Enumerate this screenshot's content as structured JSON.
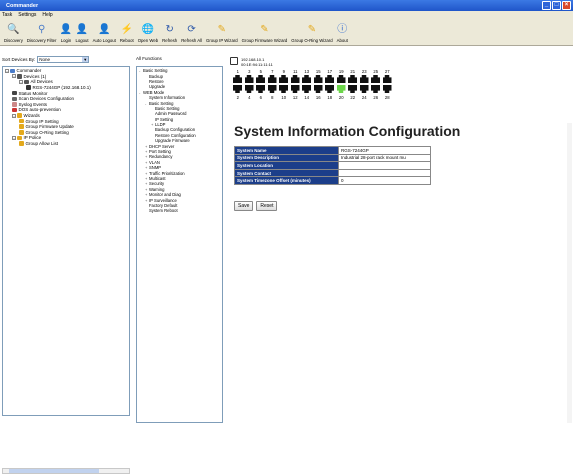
{
  "window": {
    "title": "Commander"
  },
  "menu": [
    "Task",
    "Settings",
    "Help"
  ],
  "toolbar": [
    {
      "label": "Discovery",
      "icon": "magnifier-icon",
      "color": "#4a7cc9"
    },
    {
      "label": "Discovery Filter",
      "icon": "filter-icon",
      "color": "#4a7cc9"
    },
    {
      "label": "Login",
      "icon": "login-icon",
      "color": "#3b6fc0"
    },
    {
      "label": "Logout",
      "icon": "logout-icon",
      "color": "#3b6fc0"
    },
    {
      "label": "Auto Logout",
      "icon": "auto-logout-icon",
      "color": "#3ea63b"
    },
    {
      "label": "Reboot",
      "icon": "reboot-icon",
      "color": "#d13a2f"
    },
    {
      "label": "Open Web",
      "icon": "open-web-icon",
      "color": "#3b6fc0"
    },
    {
      "label": "Refresh",
      "icon": "refresh-icon",
      "color": "#2b57a8"
    },
    {
      "label": "Refresh All",
      "icon": "refresh-all-icon",
      "color": "#2b57a8"
    },
    {
      "label": "Group IP Wizard",
      "icon": "wand-icon",
      "color": "#e3a91d"
    },
    {
      "label": "Group Firmware Wizard",
      "icon": "wand-icon",
      "color": "#e3a91d"
    },
    {
      "label": "Group O-Ring Wizard",
      "icon": "wand-icon",
      "color": "#e3a91d"
    },
    {
      "label": "About",
      "icon": "info-icon",
      "color": "#2a66d0"
    }
  ],
  "left": {
    "sort_label": "Sort Devices By:",
    "sort_value": "None",
    "tree": [
      {
        "label": "Commander",
        "depth": 0,
        "box": "-",
        "icon": "#4a7cc9"
      },
      {
        "label": "Devices (1)",
        "depth": 1,
        "box": "-",
        "icon": "#555"
      },
      {
        "label": "All Devices",
        "depth": 2,
        "box": "-",
        "icon": "#555"
      },
      {
        "label": "RGS-7244GP (192.168.10.1)",
        "depth": 3,
        "box": "",
        "icon": "#333"
      },
      {
        "label": "Status Monitor",
        "depth": 1,
        "box": "",
        "icon": "#444"
      },
      {
        "label": "Scan Devices Configuration",
        "depth": 1,
        "box": "",
        "icon": "#666"
      },
      {
        "label": "Syslog Events",
        "depth": 1,
        "box": "",
        "icon": "#c88"
      },
      {
        "label": "DOS auto-prevention",
        "depth": 1,
        "box": "",
        "icon": "#c33"
      },
      {
        "label": "Wizards",
        "depth": 1,
        "box": "-",
        "icon": "#e3a91d"
      },
      {
        "label": "Group IP Setting",
        "depth": 2,
        "box": "",
        "icon": "#e3a91d"
      },
      {
        "label": "Group Firmware Update",
        "depth": 2,
        "box": "",
        "icon": "#e3a91d"
      },
      {
        "label": "Group O-Ring Setting",
        "depth": 2,
        "box": "",
        "icon": "#e3a91d"
      },
      {
        "label": "IP Police",
        "depth": 1,
        "box": "-",
        "icon": "#e3a91d"
      },
      {
        "label": "Group Allow List",
        "depth": 2,
        "box": "",
        "icon": "#e3a91d"
      }
    ]
  },
  "functions": {
    "label": "All Functions",
    "items": [
      {
        "label": "Basic Setting",
        "depth": 0,
        "exp": "-"
      },
      {
        "label": "Backup",
        "depth": 1,
        "exp": ""
      },
      {
        "label": "Restore",
        "depth": 1,
        "exp": ""
      },
      {
        "label": "Upgrade",
        "depth": 1,
        "exp": ""
      },
      {
        "label": "WEB Mode",
        "depth": 0,
        "exp": "-"
      },
      {
        "label": "System Information",
        "depth": 1,
        "exp": ""
      },
      {
        "label": "Basic Setting",
        "depth": 1,
        "exp": "-"
      },
      {
        "label": "Basic Setting",
        "depth": 2,
        "exp": ""
      },
      {
        "label": "Admin Password",
        "depth": 2,
        "exp": ""
      },
      {
        "label": "IP Setting",
        "depth": 2,
        "exp": ""
      },
      {
        "label": "LLDP",
        "depth": 2,
        "exp": "+"
      },
      {
        "label": "Backup Configuration",
        "depth": 2,
        "exp": ""
      },
      {
        "label": "Restore Configuration",
        "depth": 2,
        "exp": ""
      },
      {
        "label": "Upgrade Firmware",
        "depth": 2,
        "exp": ""
      },
      {
        "label": "DHCP Server",
        "depth": 1,
        "exp": "+"
      },
      {
        "label": "Port Setting",
        "depth": 1,
        "exp": "+"
      },
      {
        "label": "Redundancy",
        "depth": 1,
        "exp": "+"
      },
      {
        "label": "VLAN",
        "depth": 1,
        "exp": "+"
      },
      {
        "label": "SNMP",
        "depth": 1,
        "exp": "+"
      },
      {
        "label": "Traffic Prioritization",
        "depth": 1,
        "exp": "+"
      },
      {
        "label": "Multicast",
        "depth": 1,
        "exp": "+"
      },
      {
        "label": "Security",
        "depth": 1,
        "exp": "+"
      },
      {
        "label": "Warning",
        "depth": 1,
        "exp": "+"
      },
      {
        "label": "Monitor and Diag",
        "depth": 1,
        "exp": "+"
      },
      {
        "label": "IP Surveillance",
        "depth": 1,
        "exp": "+"
      },
      {
        "label": "Factory Default",
        "depth": 1,
        "exp": ""
      },
      {
        "label": "System Reboot",
        "depth": 1,
        "exp": ""
      }
    ]
  },
  "device": {
    "ip": "192.168.10.1",
    "mac": "00:1E:94:11:11:11",
    "top_ports": [
      "1",
      "3",
      "5",
      "7",
      "9",
      "11",
      "13",
      "15",
      "17",
      "19",
      "21",
      "23",
      "25",
      "27"
    ],
    "bottom_ports": [
      "2",
      "4",
      "6",
      "8",
      "10",
      "12",
      "14",
      "16",
      "18",
      "20",
      "22",
      "24",
      "26",
      "28"
    ],
    "active_port": "20",
    "active_color": "#6cd64a"
  },
  "config": {
    "title": "System Information Configuration",
    "rows": [
      {
        "label": "System Name",
        "value": "RGS-7244GP"
      },
      {
        "label": "System Description",
        "value": "Industrial 28-port rack mount mu"
      },
      {
        "label": "System Location",
        "value": ""
      },
      {
        "label": "System Contact",
        "value": ""
      },
      {
        "label": "System Timezone Offset (minutes)",
        "value": "0"
      }
    ],
    "save_label": "Save",
    "reset_label": "Reset",
    "header_color": "#1c3e8a"
  }
}
